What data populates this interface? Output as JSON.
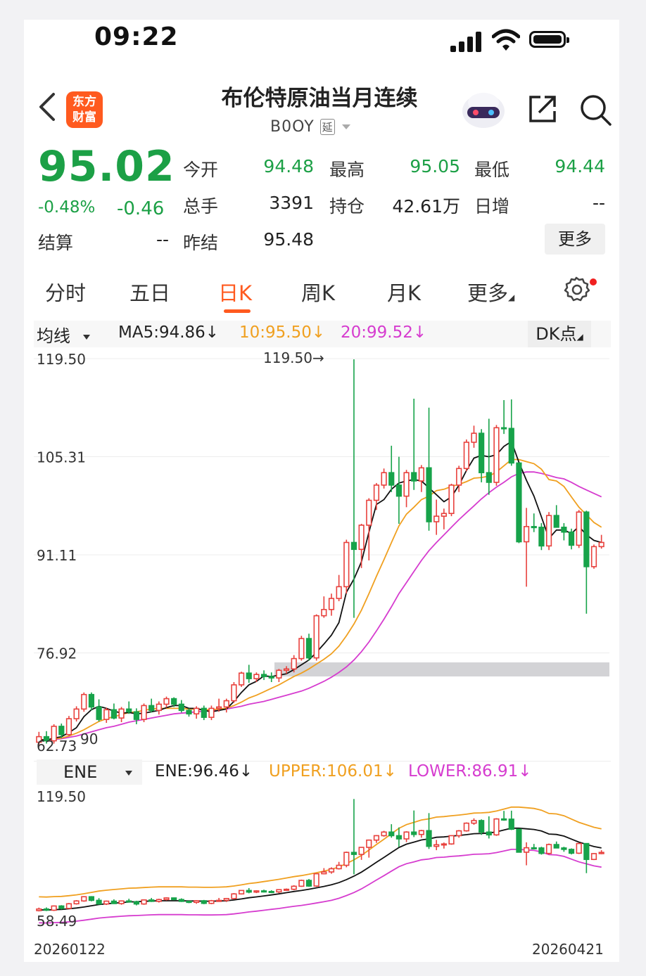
{
  "status": {
    "time": "09:22"
  },
  "header": {
    "logo_text_line1": "东方",
    "logo_text_line2": "财富",
    "title": "布伦特原油当月连续",
    "code": "B0OY",
    "delay_badge": "延"
  },
  "quote": {
    "price": "95.02",
    "change_pct": "-0.48%",
    "change": "-0.46",
    "rows": [
      [
        {
          "label": "今开",
          "value": "94.48",
          "color": "green"
        },
        {
          "label": "最高",
          "value": "95.05",
          "color": "green"
        },
        {
          "label": "最低",
          "value": "94.44",
          "color": "green"
        }
      ],
      [
        {
          "label": "总手",
          "value": "3391",
          "color": "black"
        },
        {
          "label": "持仓",
          "value": "42.61万",
          "color": "black"
        },
        {
          "label": "日增",
          "value": "--",
          "color": "black"
        }
      ]
    ],
    "settle_label": "结算",
    "settle_value": "--",
    "prev_settle_label": "昨结",
    "prev_settle_value": "95.48",
    "more_label": "更多"
  },
  "tabs": [
    {
      "label": "分时"
    },
    {
      "label": "五日"
    },
    {
      "label": "日K",
      "active": true
    },
    {
      "label": "周K"
    },
    {
      "label": "月K"
    },
    {
      "label": "更多"
    }
  ],
  "ma_bar": {
    "select_label": "均线",
    "ma5": "MA5:94.86↓",
    "ma10": "10:95.50↓",
    "ma20": "20:99.52↓",
    "dk_label": "DK点"
  },
  "ene_bar": {
    "select_label": "ENE",
    "ene": "ENE:96.46↓",
    "upper": "UPPER:106.01↓",
    "lower": "LOWER:86.91↓"
  },
  "colors": {
    "up": "#e8413d",
    "down": "#17a34a",
    "ma5": "#111111",
    "ma10": "#f0a020",
    "ma20": "#d63ccf",
    "accent": "#ff5a1f"
  },
  "chart_data": {
    "type": "candlestick",
    "x_start": "20260122",
    "x_end": "20260421",
    "main_axis_ticks": [
      "119.50",
      "105.31",
      "91.11",
      "76.92"
    ],
    "main_max_label": "119.50→",
    "main_min_label": "62.73",
    "main_extra_label": "90",
    "ene_axis_ticks": [
      "119.50",
      "58.49"
    ],
    "ylim": [
      62.73,
      119.5
    ],
    "candles": [
      [
        64,
        65.5,
        63.6,
        64.8
      ],
      [
        64.8,
        65.6,
        63.8,
        64.2
      ],
      [
        64.2,
        66.6,
        63.8,
        66.3
      ],
      [
        66.3,
        66.7,
        64.6,
        65.1
      ],
      [
        65.1,
        67.8,
        64.9,
        67.4
      ],
      [
        67.4,
        69.2,
        67,
        68.8
      ],
      [
        68.8,
        71.2,
        68.4,
        70.9
      ],
      [
        70.9,
        71.2,
        68.6,
        69.1
      ],
      [
        69.1,
        70.2,
        67,
        67.3
      ],
      [
        67.3,
        69,
        66.8,
        68.7
      ],
      [
        68.7,
        69.6,
        67.3,
        67.5
      ],
      [
        67.5,
        69.1,
        66.9,
        68.8
      ],
      [
        68.8,
        69.9,
        68.1,
        68.4
      ],
      [
        68.4,
        68.9,
        66.6,
        67.3
      ],
      [
        67.3,
        69.6,
        66.9,
        69.3
      ],
      [
        69.3,
        70.3,
        68.3,
        68.6
      ],
      [
        68.6,
        69.9,
        68,
        69.5
      ],
      [
        69.5,
        70.6,
        69,
        70.3
      ],
      [
        70.3,
        70.5,
        69.1,
        69.5
      ],
      [
        69.5,
        70.1,
        68.3,
        68.6
      ],
      [
        68.6,
        68.9,
        67.7,
        68.1
      ],
      [
        68.1,
        69.2,
        67.4,
        68.9
      ],
      [
        68.9,
        69.3,
        67.2,
        67.6
      ],
      [
        67.6,
        69.3,
        67.2,
        68.9
      ],
      [
        68.9,
        70.3,
        68.4,
        69.1
      ],
      [
        69.1,
        70.3,
        68.3,
        70
      ],
      [
        70,
        72.7,
        69.7,
        72.3
      ],
      [
        72.3,
        74.2,
        72,
        74
      ],
      [
        74,
        75.2,
        72.6,
        73.2
      ],
      [
        73.2,
        74.1,
        72.7,
        73.8
      ],
      [
        73.8,
        74.4,
        73,
        73.5
      ],
      [
        73.5,
        74.1,
        72.7,
        73.3
      ],
      [
        73.3,
        74.6,
        72.7,
        74.4
      ],
      [
        74.4,
        75,
        73.9,
        74.6
      ],
      [
        74.6,
        76.6,
        74.1,
        76.1
      ],
      [
        76.1,
        79.4,
        75.8,
        79
      ],
      [
        79,
        79.7,
        75.8,
        76.2
      ],
      [
        76.2,
        82.5,
        75.8,
        82.3
      ],
      [
        82.3,
        85.1,
        82,
        83.2
      ],
      [
        83.2,
        85.5,
        82.3,
        84.8
      ],
      [
        84.8,
        88.2,
        84.4,
        86.5
      ],
      [
        86.5,
        93.3,
        85.5,
        92.9
      ],
      [
        92.9,
        119.4,
        82,
        91.9
      ],
      [
        91.9,
        95.6,
        89.2,
        95.4
      ],
      [
        95.4,
        99.3,
        90.3,
        99
      ],
      [
        99,
        101.5,
        97.6,
        101.2
      ],
      [
        101.2,
        103.6,
        100.7,
        103
      ],
      [
        103,
        106.9,
        100.2,
        101.2
      ],
      [
        101.2,
        105.3,
        95.6,
        99.6
      ],
      [
        99.6,
        103.4,
        98,
        103
      ],
      [
        103,
        113.7,
        100.5,
        101.8
      ],
      [
        101.8,
        104.1,
        100.2,
        103.7
      ],
      [
        103.7,
        112.4,
        94.6,
        95.9
      ],
      [
        95.9,
        99.1,
        94,
        96.7
      ],
      [
        96.7,
        97.8,
        94.8,
        97.1
      ],
      [
        97.1,
        101.4,
        96.7,
        101.2
      ],
      [
        101.2,
        104,
        100.2,
        103.6
      ],
      [
        103.6,
        107.8,
        103.2,
        107.4
      ],
      [
        107.4,
        109.8,
        106.6,
        108.7
      ],
      [
        108.7,
        109.3,
        101.6,
        103
      ],
      [
        103,
        110.8,
        99.8,
        101.6
      ],
      [
        101.6,
        109.9,
        101.1,
        109.5
      ],
      [
        109.5,
        113.5,
        108.6,
        109.4
      ],
      [
        109.4,
        113.6,
        104,
        104.4
      ],
      [
        104.4,
        97,
        92.8,
        93
      ],
      [
        93,
        97.9,
        86.5,
        95.2
      ],
      [
        95.2,
        97.1,
        94.4,
        95.1
      ],
      [
        95.1,
        95.7,
        91.8,
        92.4
      ],
      [
        92.4,
        97.3,
        91.8,
        96.8
      ],
      [
        96.8,
        98.3,
        95.6,
        95.1
      ],
      [
        95.1,
        95.7,
        93.2,
        94.4
      ],
      [
        94.4,
        94.9,
        91.9,
        92.5
      ],
      [
        92.5,
        97.6,
        92.1,
        97.3
      ],
      [
        97.3,
        97.5,
        82.6,
        89.4
      ],
      [
        89.4,
        92.6,
        89.1,
        92.3
      ],
      [
        92.3,
        94,
        92,
        92.9
      ]
    ],
    "ma5": [
      64.4,
      64.3,
      64.6,
      64.8,
      65.4,
      66.1,
      67.7,
      68.7,
      69.2,
      68.9,
      68.5,
      68.2,
      68.3,
      68.1,
      68.2,
      68.4,
      68.6,
      69,
      69.3,
      69.3,
      68.9,
      68.9,
      68.6,
      68.4,
      68.6,
      68.8,
      69.9,
      71.2,
      72.3,
      72.8,
      73.6,
      73.5,
      73.7,
      73.9,
      74.5,
      75.2,
      75.9,
      77,
      78.2,
      79.5,
      81.3,
      85.7,
      87.6,
      90.1,
      94.4,
      98.4,
      99.1,
      100.6,
      101.5,
      101.8,
      102,
      101.8,
      100.8,
      99.8,
      98.8,
      99.5,
      101.2,
      103.3,
      105.1,
      105.5,
      105.3,
      105.6,
      106.8,
      107.5,
      104.5,
      101.9,
      99.6,
      96.6,
      93.5,
      94.7,
      94.7,
      94.2,
      95.2,
      94,
      93.2,
      92.9
    ],
    "ma10": [
      64.4,
      64.3,
      64.5,
      64.6,
      64.9,
      65.3,
      65.8,
      66.4,
      67,
      67.4,
      67.7,
      68,
      68.3,
      68.4,
      68.6,
      68.8,
      68.9,
      68.9,
      68.9,
      68.9,
      68.8,
      68.8,
      68.7,
      68.7,
      68.8,
      68.9,
      69.3,
      69.8,
      70.4,
      70.8,
      71.3,
      71.8,
      72.3,
      72.9,
      73.5,
      74,
      74.6,
      75.3,
      76,
      76.8,
      77.9,
      79.4,
      81.1,
      83.1,
      85.5,
      88,
      90.4,
      92.9,
      95.3,
      97,
      98,
      99.1,
      99.6,
      100.4,
      100.6,
      101,
      101.3,
      101.7,
      102.2,
      102.3,
      102.5,
      103.1,
      104,
      104.9,
      104.9,
      104.6,
      104.3,
      103.5,
      102,
      101.8,
      101,
      99.5,
      98,
      96.9,
      95.8,
      95.1
    ],
    "ma20": [
      64.4,
      64.3,
      64.4,
      64.5,
      64.7,
      64.9,
      65.2,
      65.5,
      65.8,
      66.1,
      66.3,
      66.6,
      66.9,
      67.1,
      67.3,
      67.5,
      67.7,
      67.9,
      68.1,
      68.2,
      68.3,
      68.4,
      68.5,
      68.6,
      68.7,
      68.8,
      69,
      69.2,
      69.5,
      69.7,
      69.9,
      70.2,
      70.5,
      70.8,
      71.1,
      71.4,
      71.8,
      72.3,
      72.8,
      73.4,
      74.1,
      74.9,
      75.9,
      77.1,
      78.5,
      80.1,
      81.8,
      83.6,
      85.5,
      87.1,
      88.7,
      90.3,
      91.7,
      92.9,
      94,
      95.1,
      96.2,
      97.2,
      98.2,
      99.2,
      100.1,
      100.9,
      101.6,
      102.4,
      102.9,
      103.1,
      103.1,
      102.9,
      102.6,
      102.3,
      102.1,
      101.6,
      101,
      100.5,
      100,
      99.5
    ],
    "ene": [],
    "upper": [],
    "lower": []
  }
}
